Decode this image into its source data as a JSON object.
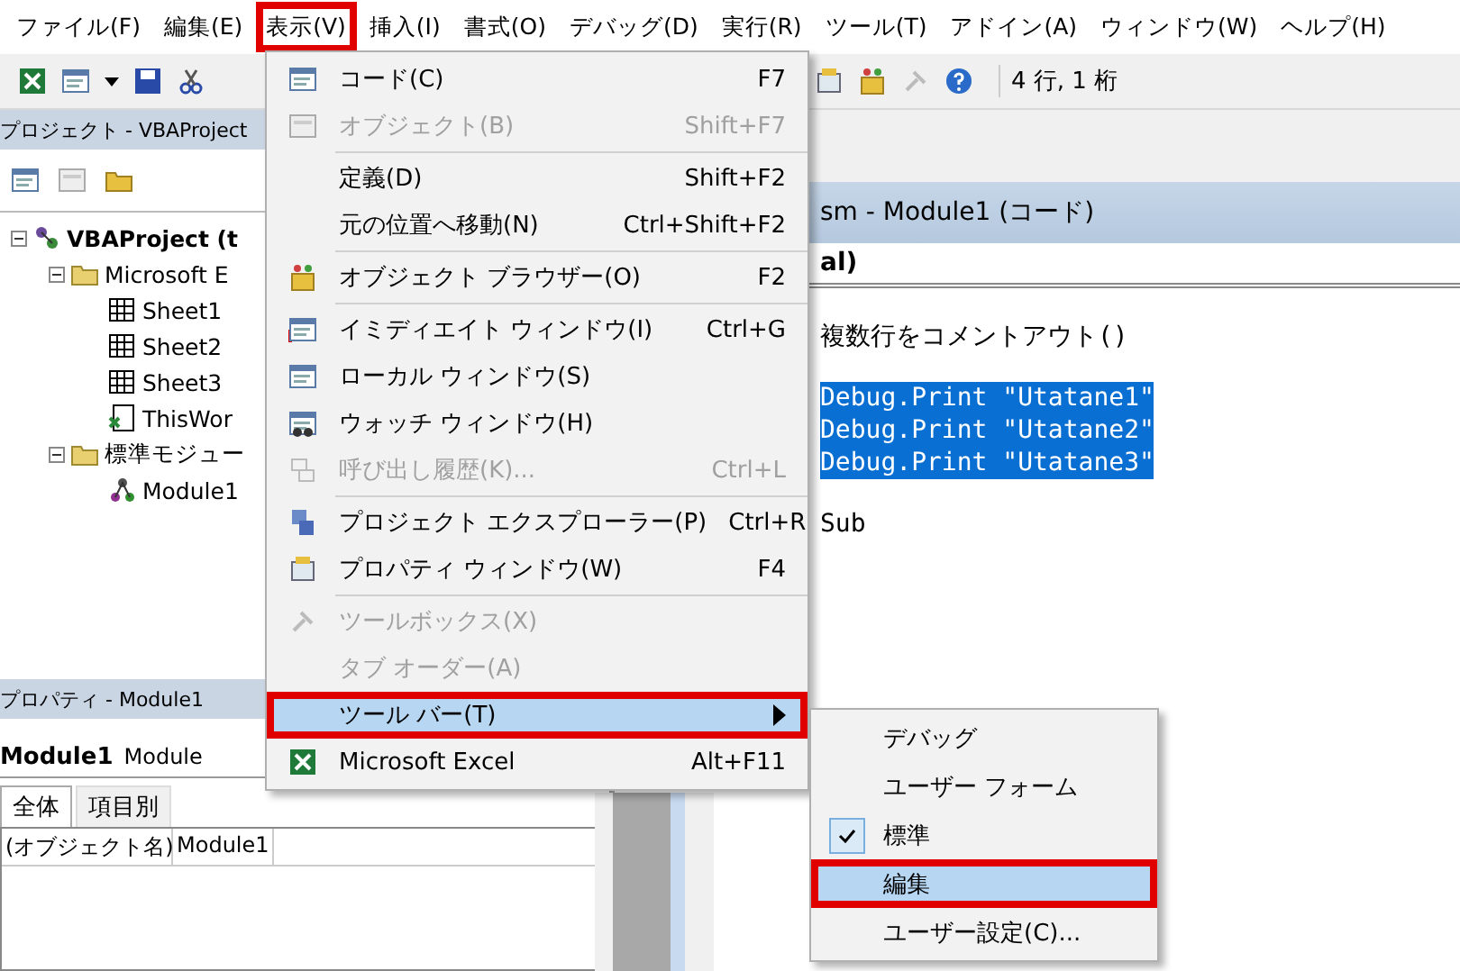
{
  "menubar": [
    {
      "label": "ファイル(F)",
      "selected": false
    },
    {
      "label": "編集(E)",
      "selected": false
    },
    {
      "label": "表示(V)",
      "selected": true
    },
    {
      "label": "挿入(I)",
      "selected": false
    },
    {
      "label": "書式(O)",
      "selected": false
    },
    {
      "label": "デバッグ(D)",
      "selected": false
    },
    {
      "label": "実行(R)",
      "selected": false
    },
    {
      "label": "ツール(T)",
      "selected": false
    },
    {
      "label": "アドイン(A)",
      "selected": false
    },
    {
      "label": "ウィンドウ(W)",
      "selected": false
    },
    {
      "label": "ヘルプ(H)",
      "selected": false
    }
  ],
  "toolbar": {
    "position": "4 行, 1 桁"
  },
  "project_pane": {
    "title": "プロジェクト - VBAProject",
    "tree": [
      {
        "label": "VBAProject (t",
        "kind": "project",
        "expanded": true,
        "children": [
          {
            "label": "Microsoft E",
            "kind": "folder",
            "expanded": true,
            "children": [
              {
                "label": "Sheet1",
                "kind": "sheet"
              },
              {
                "label": "Sheet2",
                "kind": "sheet"
              },
              {
                "label": "Sheet3",
                "kind": "sheet"
              },
              {
                "label": "ThisWor",
                "kind": "workbook"
              }
            ]
          },
          {
            "label": "標準モジュー",
            "kind": "folder",
            "expanded": true,
            "children": [
              {
                "label": "Module1",
                "kind": "module"
              }
            ]
          }
        ]
      }
    ]
  },
  "properties_pane": {
    "title": "プロパティ - Module1",
    "object_name": "Module1",
    "object_type": "Module",
    "tabs": [
      {
        "label": "全体",
        "selected": true
      },
      {
        "label": "項目別",
        "selected": false
      }
    ],
    "rows": [
      {
        "name": "(オブジェクト名)",
        "value": "Module1"
      }
    ]
  },
  "code_window": {
    "title": "sm - Module1 (コード)",
    "object_combo": "al)",
    "lines": [
      {
        "text": "複数行をコメントアウト()",
        "selected": false
      },
      {
        "text": "Debug.Print \"Utatane1\"",
        "selected": true
      },
      {
        "text": "Debug.Print \"Utatane2\"",
        "selected": true
      },
      {
        "text": "Debug.Print \"Utatane3\"",
        "selected": true
      },
      {
        "text": "Sub",
        "selected": false
      }
    ]
  },
  "view_menu": [
    {
      "label": "コード(C)",
      "shortcut": "F7",
      "kind": "code",
      "disabled": false,
      "separator_before": false,
      "selected": false
    },
    {
      "label": "オブジェクト(B)",
      "shortcut": "Shift+F7",
      "kind": "object",
      "disabled": true,
      "separator_before": false,
      "selected": false
    },
    {
      "label": "定義(D)",
      "shortcut": "Shift+F2",
      "kind": "none",
      "disabled": false,
      "separator_before": true,
      "selected": false
    },
    {
      "label": "元の位置へ移動(N)",
      "shortcut": "Ctrl+Shift+F2",
      "kind": "none",
      "disabled": false,
      "separator_before": false,
      "selected": false
    },
    {
      "label": "オブジェクト ブラウザー(O)",
      "shortcut": "F2",
      "kind": "browser",
      "disabled": false,
      "separator_before": true,
      "selected": false
    },
    {
      "label": "イミディエイト ウィンドウ(I)",
      "shortcut": "Ctrl+G",
      "kind": "immediate",
      "disabled": false,
      "separator_before": true,
      "selected": false
    },
    {
      "label": "ローカル ウィンドウ(S)",
      "kind": "code",
      "disabled": false,
      "separator_before": false,
      "selected": false
    },
    {
      "label": "ウォッチ ウィンドウ(H)",
      "kind": "watch",
      "disabled": false,
      "separator_before": false,
      "selected": false
    },
    {
      "label": "呼び出し履歴(K)...",
      "shortcut": "Ctrl+L",
      "kind": "stack",
      "disabled": true,
      "separator_before": false,
      "selected": false
    },
    {
      "label": "プロジェクト エクスプローラー(P)",
      "shortcut": "Ctrl+R",
      "kind": "explorer",
      "disabled": false,
      "separator_before": true,
      "selected": false
    },
    {
      "label": "プロパティ ウィンドウ(W)",
      "shortcut": "F4",
      "kind": "properties",
      "disabled": false,
      "separator_before": false,
      "selected": false
    },
    {
      "label": "ツールボックス(X)",
      "kind": "tools",
      "disabled": true,
      "separator_before": true,
      "selected": false
    },
    {
      "label": "タブ オーダー(A)",
      "kind": "none",
      "disabled": true,
      "separator_before": false,
      "selected": false
    },
    {
      "label": "ツール バー(T)",
      "kind": "submenu",
      "disabled": false,
      "separator_before": false,
      "selected": true
    },
    {
      "label": "Microsoft Excel",
      "shortcut": "Alt+F11",
      "kind": "excel",
      "disabled": false,
      "separator_before": false,
      "selected": false
    }
  ],
  "toolbar_submenu": [
    {
      "label": "デバッグ",
      "checked": false,
      "selected": false
    },
    {
      "label": "ユーザー フォーム",
      "checked": false,
      "selected": false
    },
    {
      "label": "標準",
      "checked": true,
      "selected": false
    },
    {
      "label": "編集",
      "checked": false,
      "selected": true
    },
    {
      "label": "ユーザー設定(C)...",
      "checked": false,
      "selected": false
    }
  ]
}
